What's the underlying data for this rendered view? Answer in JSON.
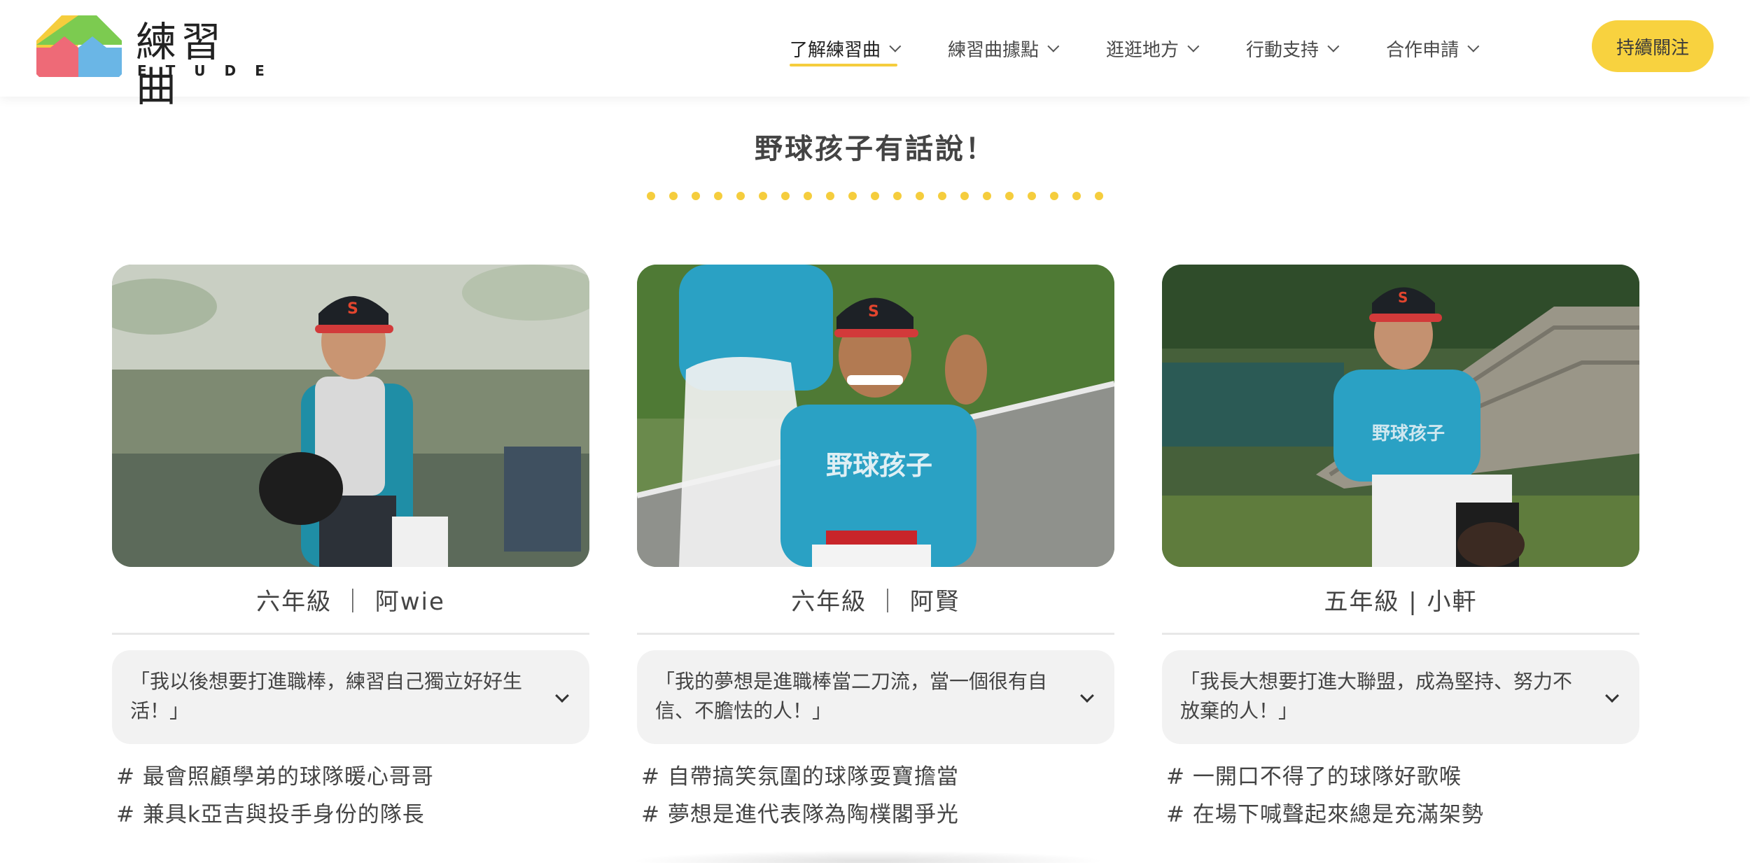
{
  "brand": {
    "name": "練習曲",
    "sub": "ETUDE",
    "colors": {
      "yellow": "#f5cd3d",
      "green": "#7ccb50",
      "red": "#ee6a77",
      "blue": "#6ab6e6"
    }
  },
  "nav": {
    "items": [
      {
        "label": "了解練習曲",
        "active": true
      },
      {
        "label": "練習曲據點",
        "active": false
      },
      {
        "label": "逛逛地方",
        "active": false
      },
      {
        "label": "行動支持",
        "active": false
      },
      {
        "label": "合作申請",
        "active": false
      }
    ],
    "cta": "持續關注"
  },
  "section": {
    "title": "野球孩子有話說！"
  },
  "cards": [
    {
      "name": "六年級 ｜ 阿wie",
      "quote": "「我以後想要打進職棒，練習自己獨立好好生活！」",
      "tags": [
        "# 最會照顧學弟的球隊暖心哥哥",
        "# 兼具k亞吉與投手身份的隊長"
      ]
    },
    {
      "name": "六年級 ｜ 阿賢",
      "quote": "「我的夢想是進職棒當二刀流，當一個很有自信、不膽怯的人！」",
      "tags": [
        "# 自帶搞笑氛圍的球隊耍寶擔當",
        "# 夢想是進代表隊為陶樸閣爭光"
      ]
    },
    {
      "name": "五年級 | 小軒",
      "quote": "「我長大想要打進大聯盟，成為堅持、努力不放棄的人！」",
      "tags": [
        "# 一開口不得了的球隊好歌喉",
        "# 在場下喊聲起來總是充滿架勢"
      ]
    }
  ]
}
